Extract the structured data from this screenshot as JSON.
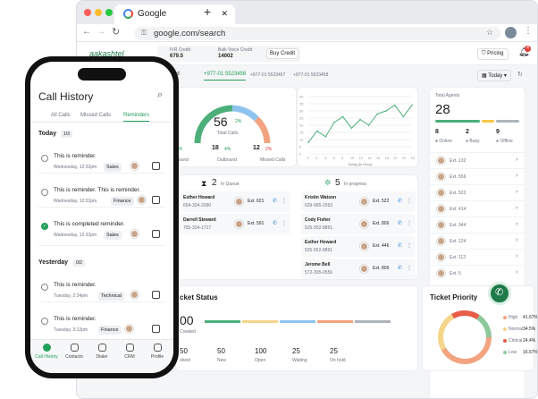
{
  "browser": {
    "tab_title": "Google",
    "new_tab": "+",
    "url": "google.com/search",
    "back": "←",
    "forward": "→",
    "reload": "↻"
  },
  "header": {
    "logo": "aakashtel",
    "ivr_label": "IVR Credit",
    "ivr_value": "679.5",
    "bulk_label": "Bulk Voice Credit",
    "bulk_value": "14002",
    "buy_credit": "Buy Credit",
    "pricing": "Pricing",
    "notif_count": "4",
    "date_filter": "Today",
    "selected_label": "ected",
    "numbers": [
      "+977-01 5523456",
      "+977-01 5523457",
      "+977-01 5523458"
    ]
  },
  "calls": {
    "total": "56",
    "total_change": "2%",
    "total_label": "Total Calls",
    "inbound_change": "8%",
    "inbound_label": "bound",
    "outbound_value": "18",
    "outbound_change": "4%",
    "outbound_label": "Outbound",
    "missed_value": "12",
    "missed_change": "2%",
    "missed_label": "Missed Calls"
  },
  "chart_data": {
    "type": "line",
    "xlabel": "Today (in Hour)",
    "x": [
      0,
      2,
      4,
      6,
      8,
      10,
      12,
      14,
      16,
      18,
      20,
      22,
      24
    ],
    "x_ticks": [
      "0",
      "2",
      "4",
      "6",
      "8",
      "10",
      "12",
      "14",
      "16",
      "18",
      "20",
      "22",
      "24"
    ],
    "y_ticks": [
      "0",
      "5",
      "10",
      "15",
      "20",
      "25",
      "30",
      "35",
      "40"
    ],
    "values": [
      8,
      16,
      12,
      22,
      26,
      18,
      24,
      20,
      28,
      30,
      34,
      26,
      34
    ],
    "ylim": [
      0,
      40
    ],
    "series_color": "#4caf7a"
  },
  "agents": {
    "title": "Total Agents",
    "total": "28",
    "online_count": "8",
    "online_label": "Online",
    "busy_count": "2",
    "busy_label": "Busy",
    "offline_count": "9",
    "offline_label": "Offline",
    "list": [
      {
        "ext": "Ext. 132"
      },
      {
        "ext": "Ext. 556"
      },
      {
        "ext": "Ext. 522"
      },
      {
        "ext": "Ext. 414"
      },
      {
        "ext": "Ext. 944"
      },
      {
        "ext": "Ext. 124"
      },
      {
        "ext": "Ext. 112"
      },
      {
        "ext": "Ext. 5"
      }
    ]
  },
  "queue": {
    "count": "2",
    "label": "In Queue",
    "progress_count": "5",
    "progress_label": "In progress",
    "left": [
      {
        "name": "Esther Howard",
        "phone": "654-334-3390",
        "ext": "Ext. 621"
      },
      {
        "name": "Darrell Steward",
        "phone": "765-334-1717",
        "ext": "Ext. 591"
      }
    ],
    "right": [
      {
        "name": "Kristin Watson",
        "phone": "639-995-1593",
        "ext": "Ext. 522"
      },
      {
        "name": "Cody Fisher",
        "phone": "525-552-8891",
        "ext": "Ext. 806"
      },
      {
        "name": "Esther Howard",
        "phone": "525-552-8891",
        "ext": "Ext. 446"
      },
      {
        "name": "Jerome Bell",
        "phone": "572-395-0556",
        "ext": "Ext. 806"
      }
    ]
  },
  "ticket_status": {
    "title": "cket Status",
    "total": "00",
    "created": "Created",
    "items": [
      {
        "value": "50",
        "label": "olved"
      },
      {
        "value": "50",
        "label": "New"
      },
      {
        "value": "100",
        "label": "Open"
      },
      {
        "value": "25",
        "label": "Waiting"
      },
      {
        "value": "25",
        "label": "On hold"
      }
    ]
  },
  "ticket_priority": {
    "title": "Ticket Priority",
    "items": [
      {
        "label": "High",
        "value": "41.67%",
        "color": "#f3a37f"
      },
      {
        "label": "Normal",
        "value": "34.5%",
        "color": "#f5d58a"
      },
      {
        "label": "Critical",
        "value": "24.4%",
        "color": "#e85c4a"
      },
      {
        "label": "Low",
        "value": "16.67%",
        "color": "#8dc99a"
      }
    ]
  },
  "phone": {
    "title": "Call History",
    "tabs": [
      "All Calls",
      "Missed Calls",
      "Reminders"
    ],
    "today": "Today",
    "today_count": "1/3",
    "yesterday": "Yesterday",
    "yesterday_count": "0/2",
    "reminders": [
      {
        "text": "This is reminder.",
        "time": "Wednesday, 12:32pm",
        "tag": "Sales"
      },
      {
        "text": "This is reminder. This is reminder.",
        "time": "Wednesday, 12:32pm",
        "tag": "Finance"
      },
      {
        "text": "This is completed reminder.",
        "time": "Wednesday, 12:32pm",
        "tag": "Sales"
      },
      {
        "text": "This is reminder.",
        "time": "Tuesday, 2:24pm",
        "tag": "Technical"
      },
      {
        "text": "This is reminder.",
        "time": "Tuesday, 3:12pm",
        "tag": "Finance"
      }
    ],
    "nav": [
      "Call History",
      "Contacts",
      "Dialer",
      "CRM",
      "Profile"
    ]
  }
}
